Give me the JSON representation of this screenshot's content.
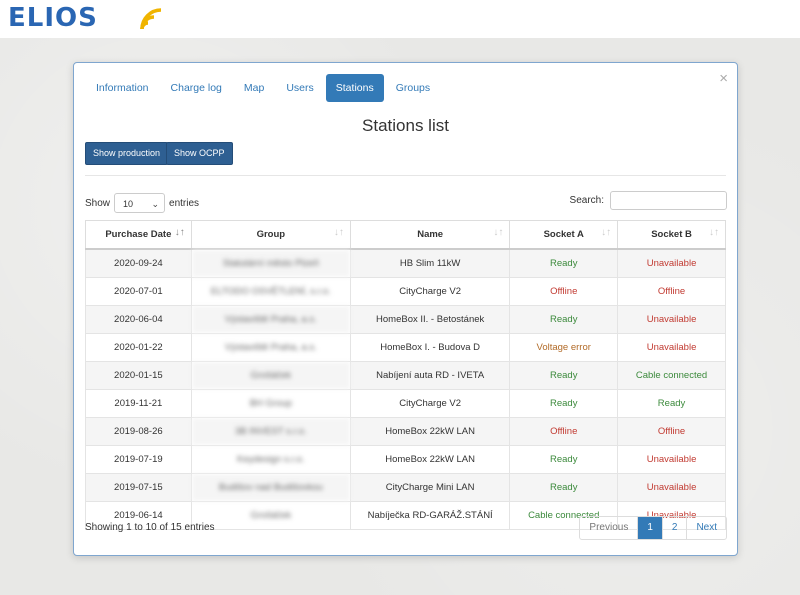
{
  "brand": {
    "logo_text": "ELIOS",
    "accent": "#337ab7",
    "logo_wave_color": "#f0b400"
  },
  "tabs": [
    {
      "label": "Information",
      "active": false
    },
    {
      "label": "Charge log",
      "active": false
    },
    {
      "label": "Map",
      "active": false
    },
    {
      "label": "Users",
      "active": false
    },
    {
      "label": "Stations",
      "active": true
    },
    {
      "label": "Groups",
      "active": false
    }
  ],
  "close_icon": "×",
  "title": "Stations list",
  "buttons": {
    "show_production": "Show production",
    "show_ocpp": "Show OCPP"
  },
  "length": {
    "prefix": "Show",
    "value": "10",
    "suffix": "entries"
  },
  "search": {
    "label": "Search:",
    "value": ""
  },
  "table": {
    "columns": [
      "Purchase Date",
      "Group",
      "Name",
      "Socket A",
      "Socket B"
    ],
    "sorted_column": 0,
    "rows": [
      {
        "date": "2020-09-24",
        "group": "Statutární město Plzeň",
        "name": "HB Slim 11kW",
        "socket_a": "Ready",
        "socket_b": "Unavailable"
      },
      {
        "date": "2020-07-01",
        "group": "ELTODO OSVĚTLENÍ, s.r.o.",
        "name": "CityCharge V2",
        "socket_a": "Offline",
        "socket_b": "Offline"
      },
      {
        "date": "2020-06-04",
        "group": "Výstaviště Praha, a.s.",
        "name": "HomeBox II. - Betostánek",
        "socket_a": "Ready",
        "socket_b": "Unavailable"
      },
      {
        "date": "2020-01-22",
        "group": "Výstaviště Praha, a.s.",
        "name": "HomeBox I. - Budova D",
        "socket_a": "Voltage error",
        "socket_b": "Unavailable"
      },
      {
        "date": "2020-01-15",
        "group": "Grošáček",
        "name": "Nabíjení auta RD - IVETA",
        "socket_a": "Ready",
        "socket_b": "Cable connected"
      },
      {
        "date": "2019-11-21",
        "group": "BH Group",
        "name": "CityCharge V2",
        "socket_a": "Ready",
        "socket_b": "Ready"
      },
      {
        "date": "2019-08-26",
        "group": "3B INVEST s.r.o.",
        "name": "HomeBox 22kW LAN",
        "socket_a": "Offline",
        "socket_b": "Offline"
      },
      {
        "date": "2019-07-19",
        "group": "Keydesign s.r.o.",
        "name": "HomeBox 22kW LAN",
        "socket_a": "Ready",
        "socket_b": "Unavailable"
      },
      {
        "date": "2019-07-15",
        "group": "Budišov nad Budišovkou",
        "name": "CityCharge Mini LAN",
        "socket_a": "Ready",
        "socket_b": "Unavailable"
      },
      {
        "date": "2019-06-14",
        "group": "Grošáček",
        "name": "Nabíječka RD-GARÁŽ.STÁNÍ",
        "socket_a": "Cable connected",
        "socket_b": "Unavailable"
      }
    ]
  },
  "info": "Showing 1 to 10 of 15 entries",
  "pagination": {
    "previous": "Previous",
    "pages": [
      "1",
      "2"
    ],
    "active": "1",
    "next": "Next"
  },
  "status_colors": {
    "Ready": "#3c8a3c",
    "Cable connected": "#3c8a3c",
    "Offline": "#c23b32",
    "Unavailable": "#c23b32",
    "Voltage error": "#b26b28"
  }
}
